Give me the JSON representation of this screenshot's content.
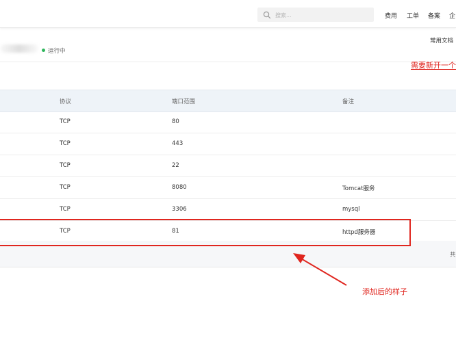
{
  "topbar": {
    "search_placeholder": "搜索...",
    "nav": [
      "费用",
      "工单",
      "备案",
      "企"
    ]
  },
  "instance": {
    "status": "运行中",
    "docs_link": "常用文档"
  },
  "annotations": {
    "top_note": "需要新开一个",
    "bottom_note": "添加后的样子"
  },
  "table": {
    "headers": {
      "protocol": "协议",
      "port_range": "端口范围",
      "remark": "备注"
    },
    "rows": [
      {
        "protocol": "TCP",
        "port": "80",
        "remark": ""
      },
      {
        "protocol": "TCP",
        "port": "443",
        "remark": ""
      },
      {
        "protocol": "TCP",
        "port": "22",
        "remark": ""
      },
      {
        "protocol": "TCP",
        "port": "8080",
        "remark": "Tomcat服务"
      },
      {
        "protocol": "TCP",
        "port": "3306",
        "remark": "mysql"
      },
      {
        "protocol": "TCP",
        "port": "81",
        "remark": "httpd服务器"
      }
    ],
    "footer_total": "共"
  },
  "colors": {
    "accent_red": "#e0261f",
    "status_green": "#2fb65c",
    "header_bg": "#eef3f8"
  }
}
